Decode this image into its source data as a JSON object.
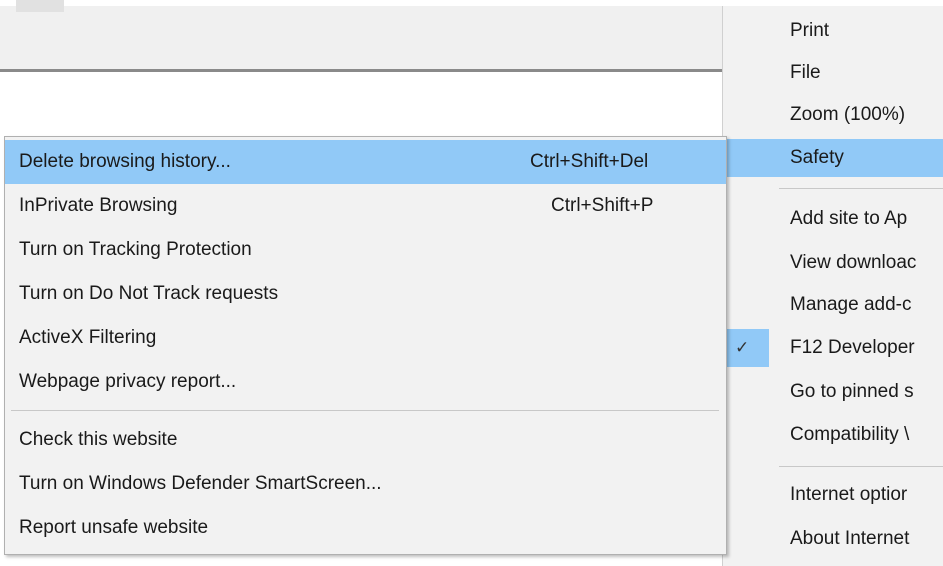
{
  "tools_menu": {
    "items": [
      {
        "label": "Print"
      },
      {
        "label": "File"
      },
      {
        "label": "Zoom (100%)"
      },
      {
        "label": "Safety",
        "active": true
      },
      {
        "label": "Add site to Ap"
      },
      {
        "label": "View downloac"
      },
      {
        "label": "Manage add-c"
      },
      {
        "label": "F12 Developer",
        "checked": true
      },
      {
        "label": "Go to pinned s"
      },
      {
        "label": "Compatibility \\"
      },
      {
        "label": "Internet optior"
      },
      {
        "label": "About Internet"
      }
    ]
  },
  "safety_submenu": {
    "items": [
      {
        "label": "Delete browsing history...",
        "shortcut": "Ctrl+Shift+Del",
        "active": true
      },
      {
        "label": "InPrivate Browsing",
        "shortcut": "Ctrl+Shift+P"
      },
      {
        "label": "Turn on Tracking Protection"
      },
      {
        "label": "Turn on Do Not Track requests"
      },
      {
        "label": "ActiveX Filtering"
      },
      {
        "label": "Webpage privacy report..."
      },
      {
        "label": "Check this website"
      },
      {
        "label": "Turn on Windows Defender SmartScreen..."
      },
      {
        "label": "Report unsafe website"
      }
    ]
  },
  "colors": {
    "highlight": "#91c9f7",
    "menu_bg": "#f2f2f2"
  },
  "icons": {
    "check": "✓"
  }
}
